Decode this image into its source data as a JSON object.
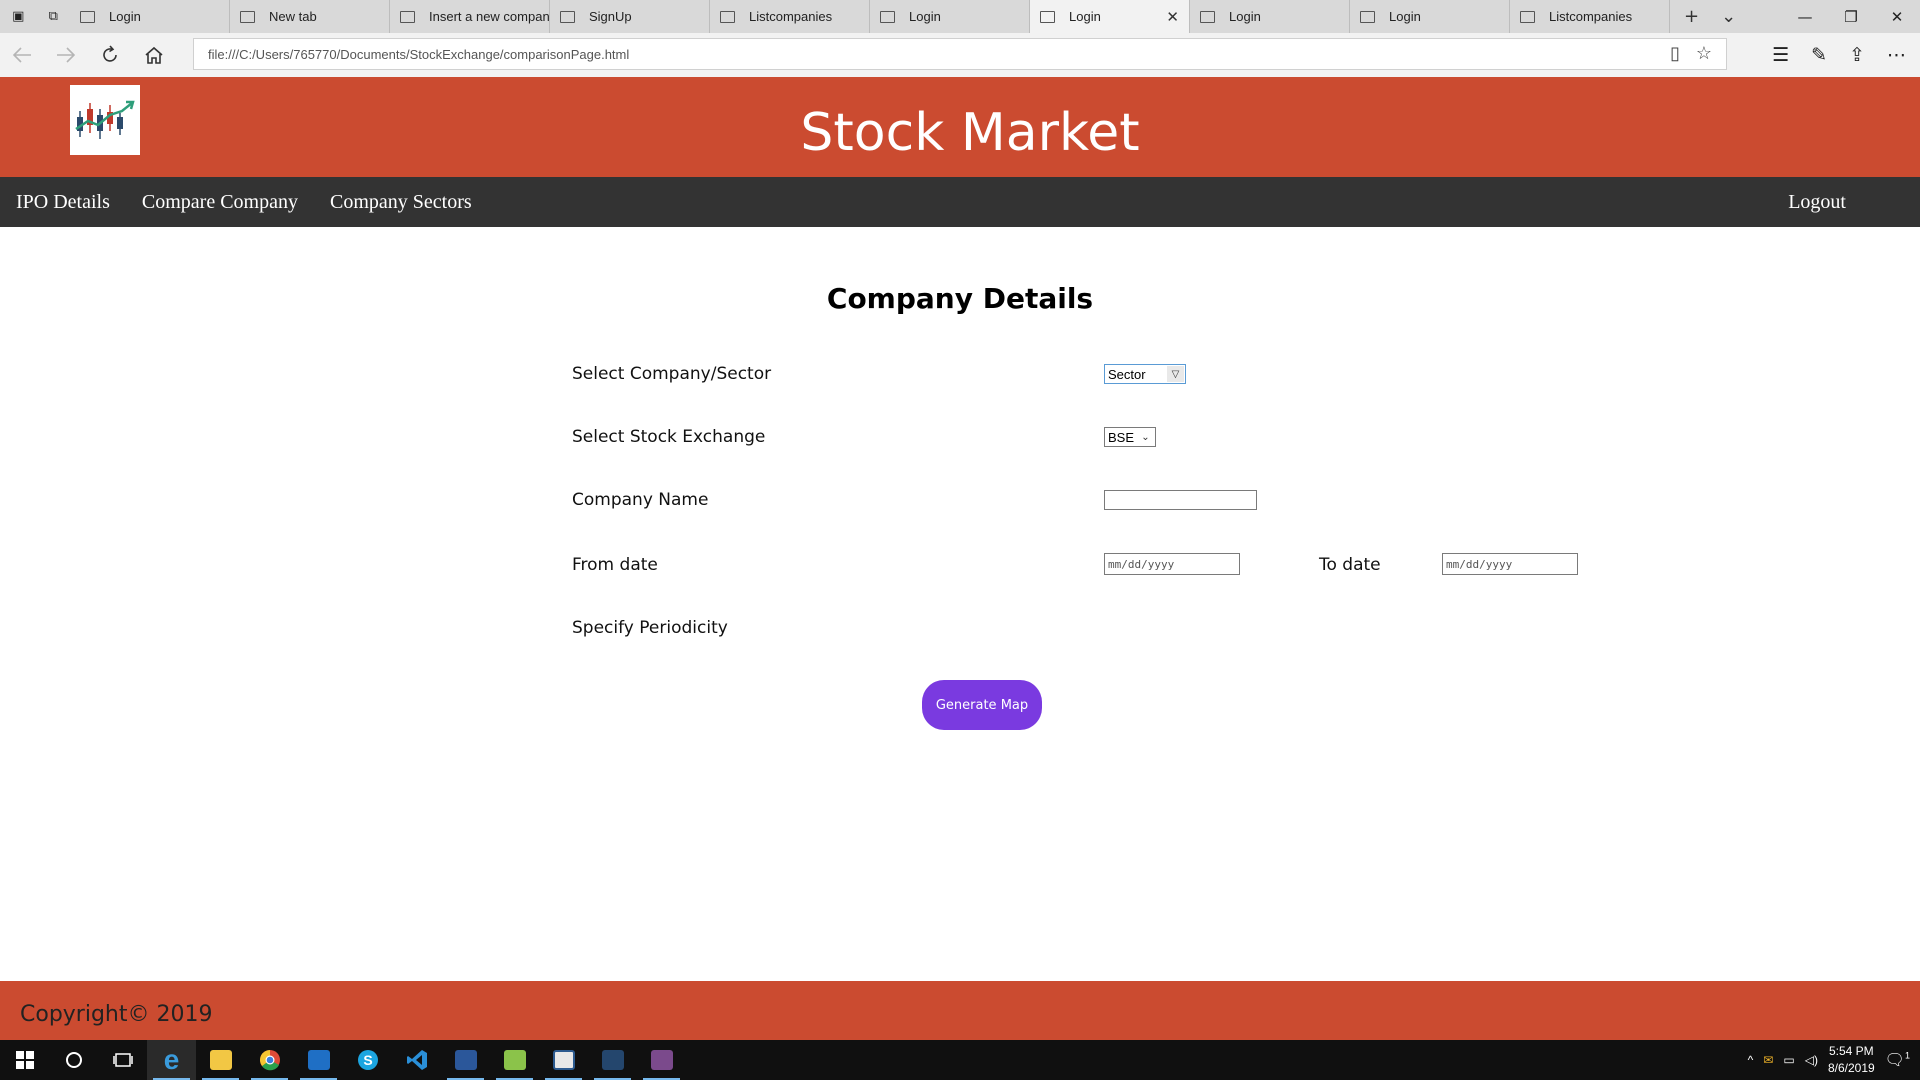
{
  "browser": {
    "tabs": [
      {
        "label": "Login",
        "active": false
      },
      {
        "label": "New tab",
        "active": false
      },
      {
        "label": "Insert a new compan",
        "active": false
      },
      {
        "label": "SignUp",
        "active": false
      },
      {
        "label": "Listcompanies",
        "active": false
      },
      {
        "label": "Login",
        "active": false
      },
      {
        "label": "Login",
        "active": true
      },
      {
        "label": "Login",
        "active": false
      },
      {
        "label": "Login",
        "active": false
      },
      {
        "label": "Listcompanies",
        "active": false
      }
    ],
    "url": "file:///C:/Users/765770/Documents/StockExchange/comparisonPage.html",
    "close_glyph": "✕",
    "new_tab_glyph": "+",
    "tab_menu_glyph": "⌄",
    "minimize_glyph": "—",
    "restore_glyph": "❐",
    "window_close_glyph": "✕"
  },
  "site": {
    "title": "Stock Market",
    "nav": {
      "ipo": "IPO Details",
      "compare": "Compare Company",
      "sectors": "Company Sectors",
      "logout": "Logout"
    },
    "footer": "Copyright© 2019",
    "brand_color": "#cb4b30",
    "nav_color": "#333333"
  },
  "form": {
    "heading": "Company Details",
    "company_sector_label": "Select Company/Sector",
    "company_sector_value": "Sector",
    "stock_exchange_label": "Select Stock Exchange",
    "stock_exchange_value": "BSE",
    "company_name_label": "Company Name",
    "company_name_value": "",
    "from_date_label": "From date",
    "from_date_placeholder": "mm/dd/yyyy",
    "to_date_label": "To date",
    "to_date_placeholder": "mm/dd/yyyy",
    "periodicity_label": "Specify Periodicity",
    "generate_button": "Generate Map",
    "button_color": "#7a3ae0"
  },
  "taskbar": {
    "time": "5:54 PM",
    "date": "8/6/2019",
    "notification_count": "1"
  }
}
